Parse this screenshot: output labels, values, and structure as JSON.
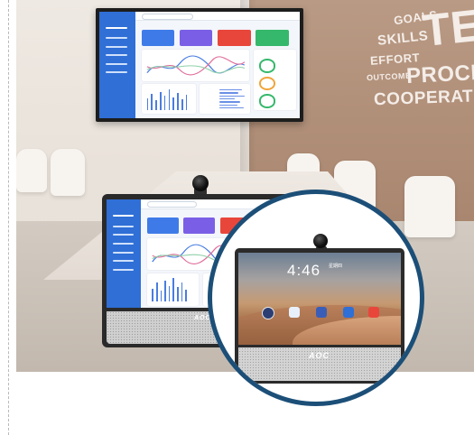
{
  "wall": {
    "words": [
      "GOALS",
      "SKILLS",
      "EFFORT",
      "OUTCOME",
      "TEA",
      "PROCESS",
      "COOPERATIO"
    ]
  },
  "devices": {
    "brand": "AOC",
    "zoom_screen": {
      "time": "4:46",
      "date_line1": "星期四",
      "date_line2": "",
      "app_colors": [
        "#2c3e73",
        "#e8f0fb",
        "#3a5eb8",
        "#2f6fd6",
        "#e9463b"
      ]
    }
  },
  "colors": {
    "accent_ring": "#1c4f78",
    "dashboard_sidebar": "#2f6fd6",
    "kpi_colors": [
      "#3f7be8",
      "#7a5fe6",
      "#e9463b",
      "#35b86b"
    ]
  }
}
